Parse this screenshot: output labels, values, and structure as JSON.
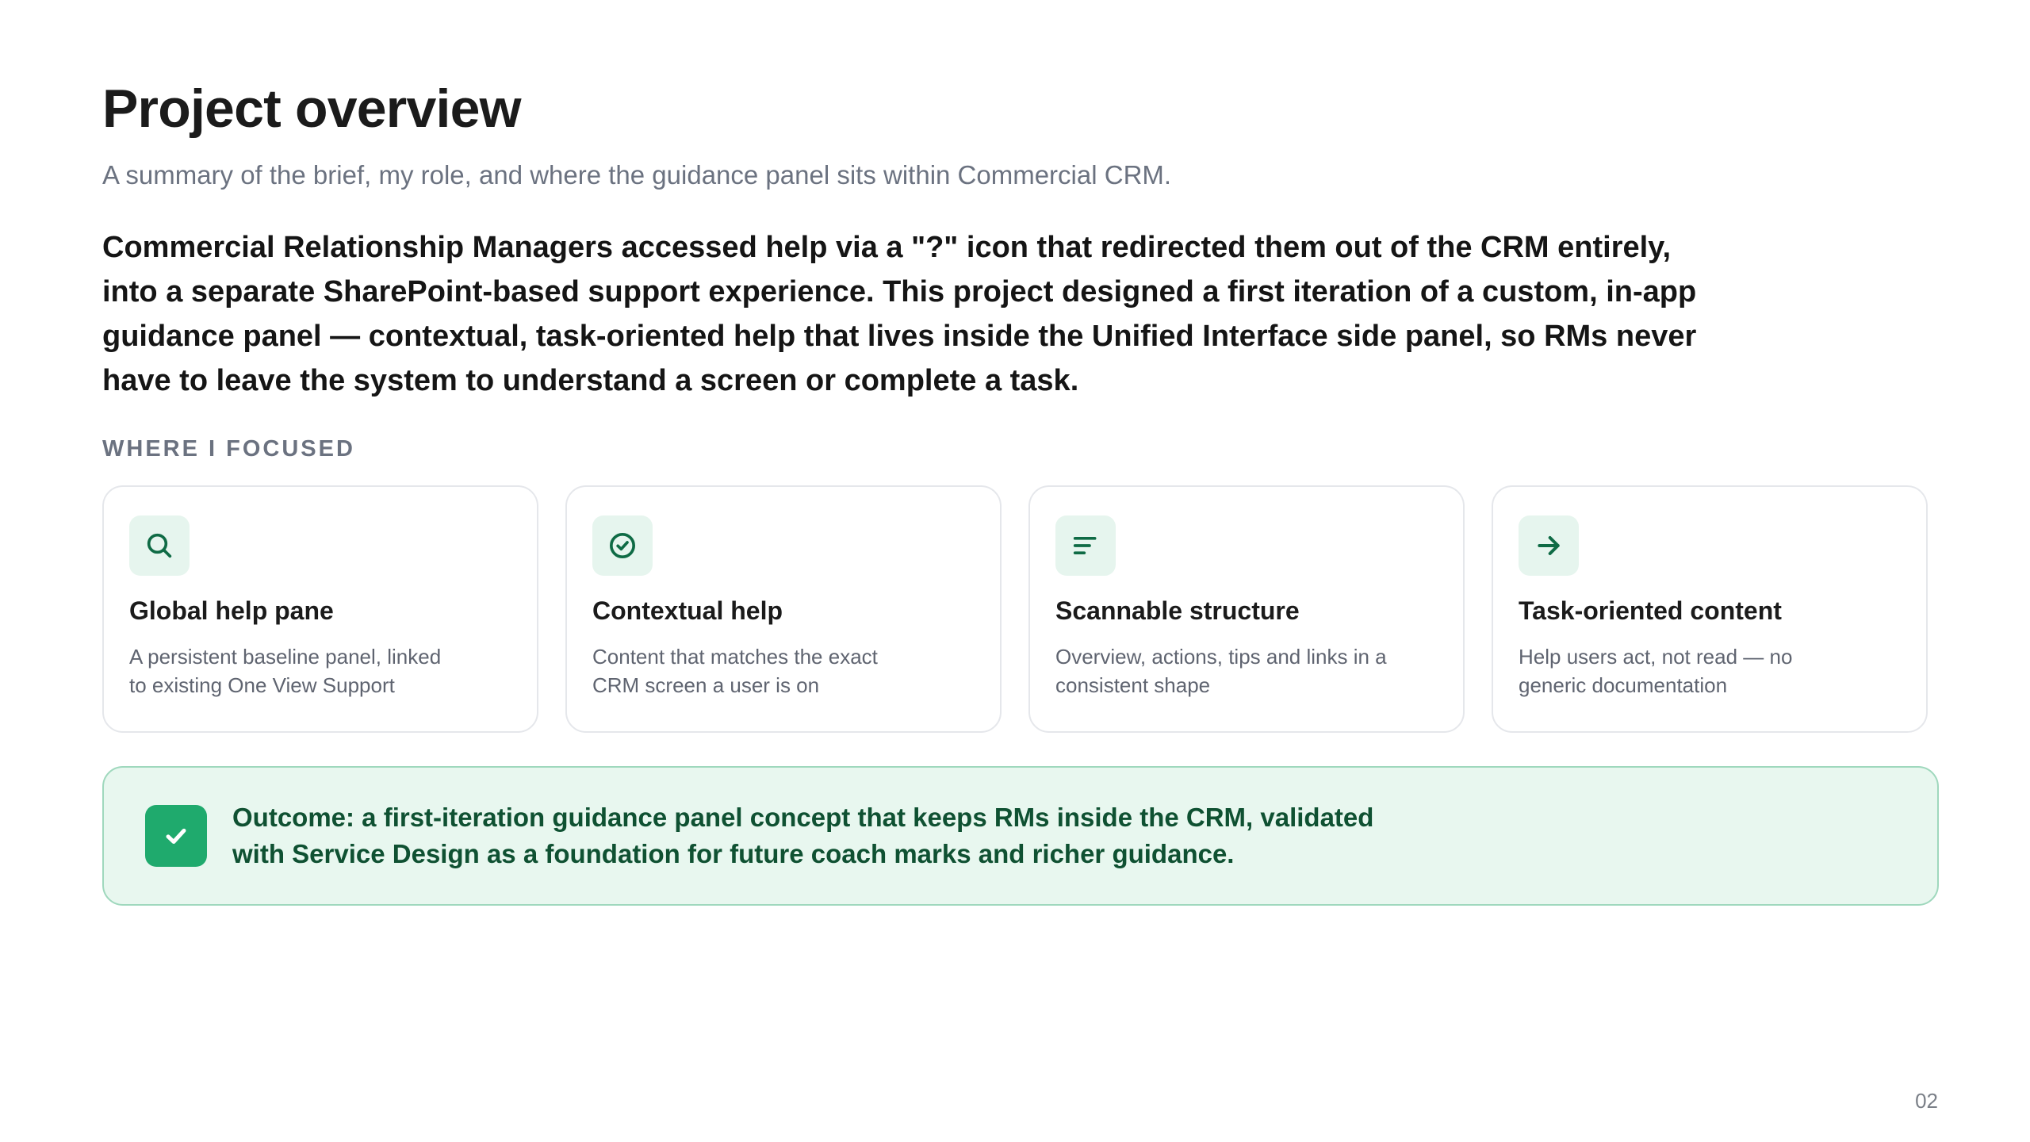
{
  "header": {
    "title": "Project overview",
    "subtitle": "A summary of the brief, my role, and where the guidance panel sits within Commercial CRM."
  },
  "lead": "Commercial Relationship Managers accessed help via a \"?\" icon that redirected them out of the CRM entirely, into a separate SharePoint-based support experience. This project designed a first iteration of a custom, in-app guidance panel — contextual, task-oriented help that lives inside the Unified Interface side panel, so RMs never have to leave the system to understand a screen or complete a task.",
  "focus": {
    "label": "WHERE I FOCUSED",
    "cards": [
      {
        "icon": "search-icon",
        "title": "Global help pane",
        "desc": "A persistent baseline panel, linked to existing One View Support"
      },
      {
        "icon": "check-circle-icon",
        "title": "Contextual help",
        "desc": "Content that matches the exact CRM screen a user is on"
      },
      {
        "icon": "lines-icon",
        "title": "Scannable structure",
        "desc": "Overview, actions, tips and links in a consistent shape"
      },
      {
        "icon": "arrow-right-icon",
        "title": "Task-oriented content",
        "desc": "Help users act, not read — no generic documentation"
      }
    ]
  },
  "outcome": {
    "icon": "check-icon",
    "text": "Outcome: a first-iteration guidance panel concept that keeps RMs inside the CRM, validated with Service Design as a foundation for future coach marks and richer guidance."
  },
  "page_number": "02",
  "colors": {
    "accent": "#1faa6d",
    "accent_dark": "#0f5132",
    "icon_bg": "#e6f5ee",
    "outcome_bg": "#e8f7ef"
  }
}
